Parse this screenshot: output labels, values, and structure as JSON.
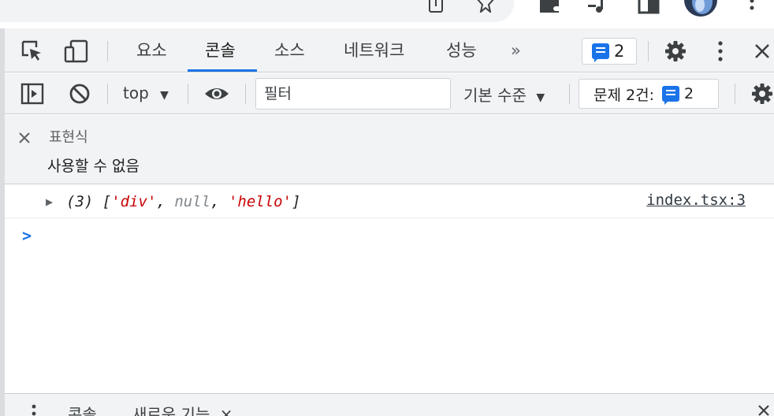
{
  "browser": {
    "icons": [
      "share-icon",
      "bookmark-star-icon",
      "extensions-icon",
      "media-control-icon",
      "side-panel-icon",
      "profile-avatar",
      "more-menu-icon"
    ]
  },
  "tabs": {
    "items": [
      {
        "label": "요소"
      },
      {
        "label": "콘솔",
        "active": true
      },
      {
        "label": "소스"
      },
      {
        "label": "네트워크"
      },
      {
        "label": "성능"
      }
    ],
    "more": "»",
    "message_count": "2"
  },
  "toolbar": {
    "context": "top",
    "filter_placeholder": "필터",
    "level": "기본 수준",
    "issues_label": "문제 2건:",
    "issues_count": "2"
  },
  "expression": {
    "title": "표현식",
    "value": "사용할 수 없음"
  },
  "log": {
    "arrow": "▶",
    "count": "(3)",
    "open_bracket": "[",
    "item1": "'div'",
    "comma1": ", ",
    "item2": "null",
    "comma2": ", ",
    "item3": "'hello'",
    "close_bracket": "]",
    "source": "index.tsx:3"
  },
  "prompt": ">",
  "drawer": {
    "console_label": "콘솔",
    "whats_new_label": "새로운 기능"
  },
  "colors": {
    "accent": "#1a73e8",
    "string": "#c80000",
    "null": "#80868b"
  }
}
